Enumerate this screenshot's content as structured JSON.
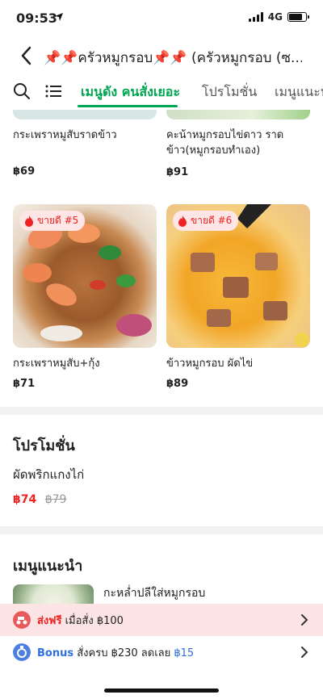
{
  "status": {
    "time": "09:53",
    "network": "4G"
  },
  "header": {
    "title": "📌📌ครัวหมูกรอบ📌📌 (ครัวหมูกรอบ (ซ..."
  },
  "tabs": [
    {
      "label": "เมนูดัง คนสั่งเยอะ",
      "active": true
    },
    {
      "label": "โปรโมชั่น",
      "active": false
    },
    {
      "label": "เมนูแนะนำ",
      "active": false
    }
  ],
  "menu_items": [
    {
      "name": "กระเพราหมูสับราดข้าว",
      "price": "฿69"
    },
    {
      "name": "คะน้าหมูกรอบไข่ดาว ราดข้าว(หมูกรอบทำเอง)",
      "price": "฿91"
    },
    {
      "name": "กระเพราหมูสับ+กุ้ง",
      "price": "฿71",
      "badge": "ขายดี #5"
    },
    {
      "name": "ข้าวหมูกรอบ ผัดไข่",
      "price": "฿89",
      "badge": "ขายดี #6"
    }
  ],
  "promotions": {
    "title": "โปรโมชั่น",
    "item": {
      "name": "ผัดพริกแกงไก่",
      "price": "฿74",
      "original_price": "฿79"
    }
  },
  "recommended": {
    "title": "เมนูแนะนำ",
    "item": {
      "name": "กะหล่ำปลีใส่หมูกรอบ"
    }
  },
  "delivery_bar": {
    "highlight": "ส่งฟรี",
    "text": "เมื่อสั่ง ฿100"
  },
  "bonus_bar": {
    "label": "Bonus",
    "text": "สั่งครบ ฿230 ลดเลย",
    "amount": "฿15"
  },
  "colors": {
    "accent": "#00a651",
    "promo_red": "#e22222",
    "bonus_blue": "#2f6fe0"
  }
}
